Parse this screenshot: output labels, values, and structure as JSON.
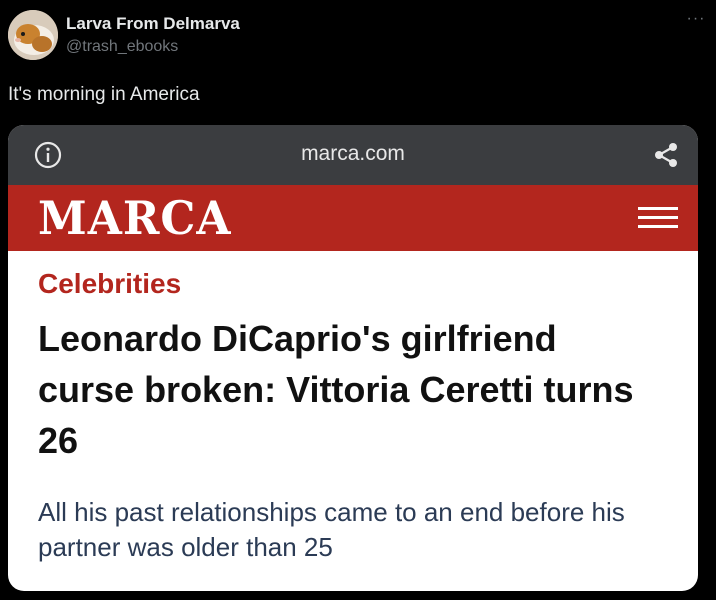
{
  "tweet": {
    "display_name": "Larva From Delmarva",
    "handle": "@trash_ebooks",
    "more_label": "···",
    "text": "It's morning in America"
  },
  "card": {
    "browser": {
      "url": "marca.com",
      "info_icon": "info-icon",
      "share_icon": "share-icon"
    },
    "site": {
      "logo": "MARCA",
      "menu_icon": "hamburger-menu-icon"
    },
    "article": {
      "category": "Celebrities",
      "headline": "Leonardo DiCaprio's girlfriend curse broken: Vittoria Ceretti turns 26",
      "subhead": "All his past relationships came to an end before his partner was older than 25"
    }
  },
  "colors": {
    "background": "#000000",
    "brand_red": "#b3261e",
    "browser_bar": "#3b3d40",
    "muted_text": "#71767b"
  }
}
